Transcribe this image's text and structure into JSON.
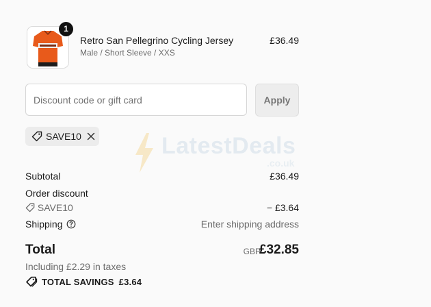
{
  "product": {
    "name": "Retro San Pellegrino Cycling Jersey",
    "variant": "Male / Short Sleeve / XXS",
    "price": "£36.49",
    "quantity": "1",
    "image_icon": "cycling-jersey-image"
  },
  "discount": {
    "placeholder": "Discount code or gift card",
    "value": "",
    "apply_label": "Apply",
    "applied_code": "SAVE10"
  },
  "watermark": {
    "text": "LatestDeals",
    "sub": ".co.uk"
  },
  "summary": {
    "subtotal_label": "Subtotal",
    "subtotal_value": "£36.49",
    "order_discount_label": "Order discount",
    "discount_code": "SAVE10",
    "discount_value": "− £3.64",
    "shipping_label": "Shipping",
    "shipping_value": "Enter shipping address",
    "total_label": "Total",
    "currency": "GBP",
    "total_value": "£32.85",
    "taxes_note": "Including £2.29 in taxes",
    "savings_label": "TOTAL SAVINGS",
    "savings_value": "£3.64"
  },
  "colors": {
    "jersey_orange": "#e85a1b",
    "badge": "#111111",
    "chip_bg": "#ececec",
    "apply_bg": "#ededed"
  }
}
